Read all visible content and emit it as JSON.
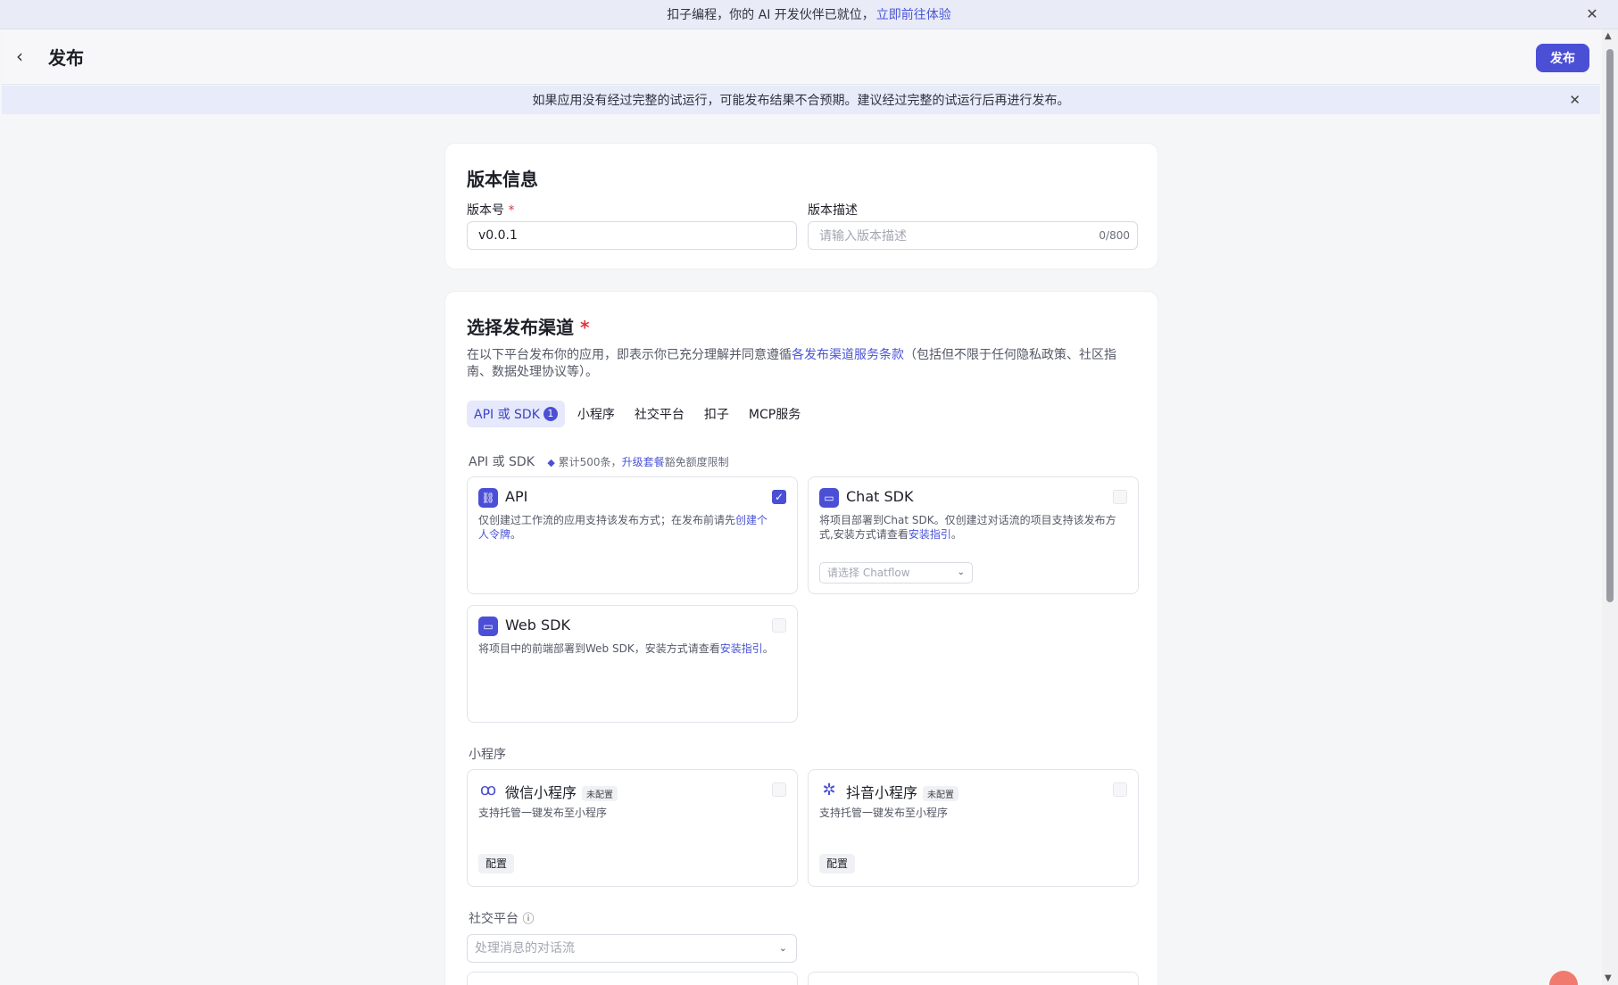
{
  "promo": {
    "text": "扣子编程，你的 AI 开发伙伴已就位，",
    "link": "立即前往体验"
  },
  "header": {
    "title": "发布",
    "publish_label": "发布"
  },
  "warning": {
    "text": "如果应用没有经过完整的试运行，可能发布结果不合预期。建议经过完整的试运行后再进行发布。"
  },
  "version_info": {
    "title": "版本信息",
    "version_label": "版本号",
    "version_value": "v0.0.1",
    "desc_label": "版本描述",
    "desc_placeholder": "请输入版本描述",
    "desc_count": "0/800"
  },
  "channel": {
    "title": "选择发布渠道",
    "desc_pre": "在以下平台发布你的应用，即表示你已充分理解并同意遵循",
    "desc_link": "各发布渠道服务条款",
    "desc_post": "（包括但不限于任何隐私政策、社区指南、数据处理协议等）。",
    "tabs": [
      {
        "label": "API 或 SDK",
        "badge": "1"
      },
      {
        "label": "小程序"
      },
      {
        "label": "社交平台"
      },
      {
        "label": "扣子"
      },
      {
        "label": "MCP服务"
      }
    ],
    "api_section": {
      "label": "API 或 SDK",
      "note_pre": "累计500条，",
      "note_link": "升级套餐",
      "note_post": "豁免额度限制"
    },
    "api": {
      "name": "API",
      "text_pre": "仅创建过工作流的应用支持该发布方式；在发布前请先",
      "text_link": "创建个人令牌",
      "text_post": "。",
      "checked": true
    },
    "chat_sdk": {
      "name": "Chat SDK",
      "text_pre": "将项目部署到Chat SDK。仅创建过对话流的项目支持该发布方式,安装方式请查看",
      "text_link": "安装指引",
      "text_post": "。",
      "select_placeholder": "请选择 Chatflow"
    },
    "web_sdk": {
      "name": "Web SDK",
      "text_pre": "将项目中的前端部署到Web SDK，安装方式请查看",
      "text_link": "安装指引",
      "text_post": "。"
    },
    "mini_section": {
      "label": "小程序"
    },
    "wechat": {
      "name": "微信小程序",
      "tag": "未配置",
      "text": "支持托管一键发布至小程序",
      "config_label": "配置"
    },
    "douyin": {
      "name": "抖音小程序",
      "tag": "未配置",
      "text": "支持托管一键发布至小程序",
      "config_label": "配置"
    },
    "social_section": {
      "label": "社交平台"
    },
    "social_select_placeholder": "处理消息的对话流"
  },
  "colors": {
    "accent": "#4b4fd6",
    "required": "#e0363c",
    "link": "#4a55d6"
  }
}
